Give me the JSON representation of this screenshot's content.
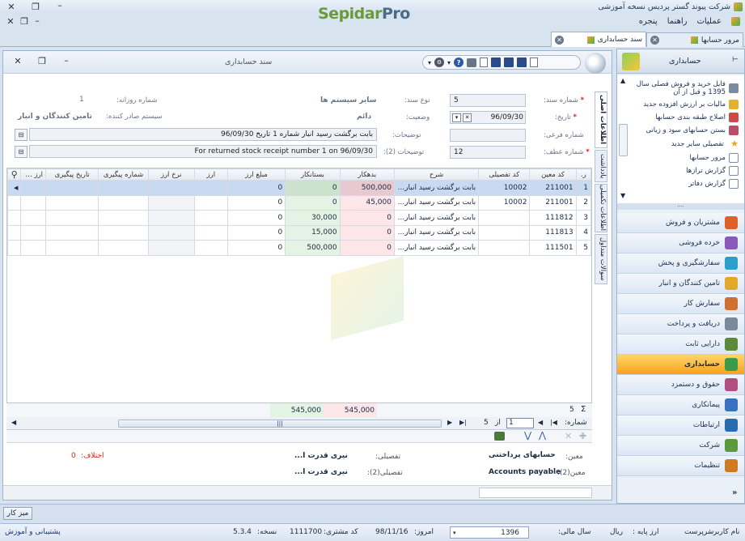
{
  "window": {
    "title": "شرکت پیوند گستر پردیس نسخه آموزشی",
    "brand_left": "Sepidar",
    "brand_right": "Pro"
  },
  "menu": [
    "عملیات",
    "راهنما",
    "پنجره"
  ],
  "tabs": [
    {
      "label": "مرور حسابها"
    },
    {
      "label": "سند حسابداری"
    }
  ],
  "doc": {
    "title": "سند حسابداری",
    "vertical_tabs": [
      "اطلاعات اصلی",
      "یادداشت",
      "اطلاعات تکمیلی",
      "سوالات متداول"
    ],
    "fields": {
      "doc_no_label": "شماره سند:",
      "doc_no": "5",
      "date_label": "تاریخ:",
      "date": "96/09/30",
      "sub_no_label": "شماره فرعی:",
      "sub_no": "",
      "ref_no_label": "شماره عطف:",
      "ref_no": "12",
      "type_label": "نوع سند:",
      "type_value": "سایر سیستم ها",
      "status_label": "وضعیت:",
      "status_value": "دائم",
      "desc_label": "توضیحات:",
      "desc_value": "بابت برگشت رسید انبار شماره 1 تاریخ 96/09/30",
      "desc2_label": "توضیحات (2):",
      "desc2_value": "For returned stock receipt number 1 on 96/09/30",
      "daily_no_label": "شماره روزانه:",
      "daily_no": "1",
      "issuer_label": "سیستم صادر کننده:",
      "issuer_value": "تامین کنندگان و انبار"
    },
    "columns": [
      "ر.",
      "کد معین",
      "کد تفصیلی",
      "شرح",
      "بدهکار",
      "بستانکار",
      "مبلغ ارز",
      "ارز",
      "نرخ ارز",
      "شماره پیگیری",
      "تاریخ پیگیری",
      "ارز (2)"
    ],
    "rows": [
      {
        "no": "1",
        "moein": "211001",
        "tafsili": "10002",
        "desc": "بابت برگشت رسید انبار...",
        "debit": "500,000",
        "credit": "0",
        "fx_amount": "0"
      },
      {
        "no": "2",
        "moein": "211001",
        "tafsili": "10002",
        "desc": "بابت برگشت رسید انبار...",
        "debit": "45,000",
        "credit": "0",
        "fx_amount": "0"
      },
      {
        "no": "3",
        "moein": "111812",
        "tafsili": "",
        "desc": "بابت برگشت رسید انبار...",
        "debit": "0",
        "credit": "30,000",
        "fx_amount": "0"
      },
      {
        "no": "4",
        "moein": "111813",
        "tafsili": "",
        "desc": "بابت برگشت رسید انبار...",
        "debit": "0",
        "credit": "15,000",
        "fx_amount": "0"
      },
      {
        "no": "5",
        "moein": "111501",
        "tafsili": "",
        "desc": "بابت برگشت رسید انبار...",
        "debit": "0",
        "credit": "500,000",
        "fx_amount": "0"
      }
    ],
    "totals": {
      "count": "5",
      "debit": "545,000",
      "credit": "545,000"
    },
    "pager": {
      "label": ":شماره",
      "current": "1",
      "of_label": "از",
      "total": "5"
    },
    "info": {
      "moein_label": "معین:",
      "moein_value": "حسابهای پرداختنی",
      "tafsili_label": "تفصیلی:",
      "tafsili_value": "نیری قدرت ا...",
      "moein2_label": "معین(2):",
      "moein2_value": "Accounts payable",
      "tafsili2_label": "تفصیلی(2):",
      "tafsili2_value": "نیری قدرت ا...",
      "diff_label": "اختلاف:",
      "diff_value": "0"
    }
  },
  "right_panel": {
    "header": "حسابداری",
    "links": [
      "فایل خرید و فروش فصلی سال 1395 و قبل از آن",
      "مالیات بر ارزش افزوده جدید",
      "اصلاح طبقه بندی حسابها",
      "بستن حسابهای سود و زیانی",
      "تفصیلی سایر جدید",
      "مرور حسابها",
      "گزارش ترازها",
      "گزارش دفاتر"
    ],
    "modules": [
      {
        "label": "مشتریان و فروش",
        "color": "#e0602a"
      },
      {
        "label": "خرده فروشی",
        "color": "#8a5ab8"
      },
      {
        "label": "سفارشگیری و پخش",
        "color": "#2aa0c8"
      },
      {
        "label": "تامین کنندگان و انبار",
        "color": "#e3a72a"
      },
      {
        "label": "سفارش کار",
        "color": "#d07030"
      },
      {
        "label": "دریافت و پرداخت",
        "color": "#7a8a9a"
      },
      {
        "label": "دارایی ثابت",
        "color": "#5a8a3a"
      },
      {
        "label": "حسابداری",
        "color": "#3a9a4a"
      },
      {
        "label": "حقوق و دستمزد",
        "color": "#b05080"
      },
      {
        "label": "پیمانکاری",
        "color": "#3a70c0"
      },
      {
        "label": "ارتباطات",
        "color": "#2a6ab0"
      },
      {
        "label": "شرکت",
        "color": "#5a9a3a"
      },
      {
        "label": "تنظیمات",
        "color": "#d07a20"
      }
    ]
  },
  "taskbar": {
    "button": "میز کار"
  },
  "status": {
    "user_label": "نام کاربر :",
    "user_value": "سرپرست",
    "fiscal_label": "سال مالی:",
    "fiscal_value": "1396",
    "currency_label": "ارز پایه :",
    "currency_value": "ریال",
    "today_label": "امروز:",
    "today_value": "98/11/16",
    "customer_label": "کد مشتری:",
    "customer_value": "1111700",
    "version_label": "نسخه:",
    "version_value": "5.3.4",
    "support": "پشتیبانی و آموزش"
  }
}
